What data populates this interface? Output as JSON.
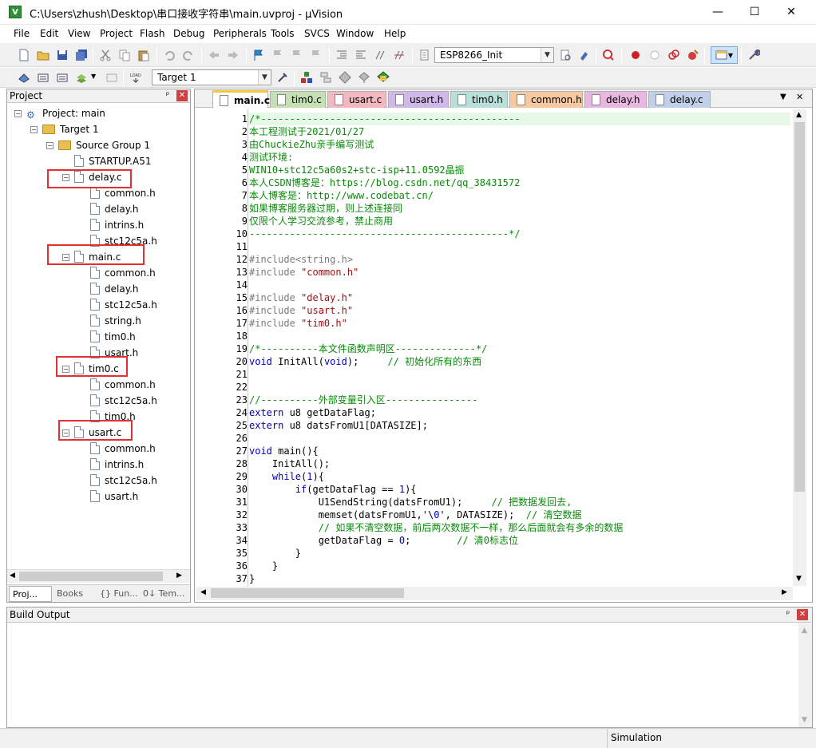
{
  "window": {
    "title": "C:\\Users\\zhush\\Desktop\\串口接收字符串\\main.uvproj - µVision",
    "app_icon_letter": "V",
    "minimize": "—",
    "maximize": "☐",
    "close": "✕"
  },
  "menu": [
    "File",
    "Edit",
    "View",
    "Project",
    "Flash",
    "Debug",
    "Peripherals",
    "Tools",
    "SVCS",
    "Window",
    "Help"
  ],
  "toolbar": {
    "target_combo": "ESP8266_Init",
    "target_select": "Target 1"
  },
  "project_panel": {
    "title": "Project",
    "pin": "ᵖ",
    "close": "✕",
    "tree": {
      "root": "Project: main",
      "target": "Target 1",
      "group": "Source Group 1",
      "files": [
        {
          "name": "STARTUP.A51",
          "children": []
        },
        {
          "name": "delay.c",
          "children": [
            "common.h",
            "delay.h",
            "intrins.h",
            "stc12c5a.h"
          ]
        },
        {
          "name": "main.c",
          "children": [
            "common.h",
            "delay.h",
            "stc12c5a.h",
            "string.h",
            "tim0.h",
            "usart.h"
          ]
        },
        {
          "name": "tim0.c",
          "children": [
            "common.h",
            "stc12c5a.h",
            "tim0.h"
          ]
        },
        {
          "name": "usart.c",
          "children": [
            "common.h",
            "intrins.h",
            "stc12c5a.h",
            "usart.h"
          ]
        }
      ]
    },
    "tabs": [
      "Proj...",
      "Books",
      "{} Fun...",
      "0↓ Tem..."
    ]
  },
  "editor": {
    "tabs": [
      {
        "label": "main.c",
        "color": "#f5c842",
        "active": true
      },
      {
        "label": "tim0.c",
        "color": "#c5e0b4",
        "active": false
      },
      {
        "label": "usart.c",
        "color": "#f4b8c0",
        "active": false
      },
      {
        "label": "usart.h",
        "color": "#d0b8e8",
        "active": false
      },
      {
        "label": "tim0.h",
        "color": "#b8e0d8",
        "active": false
      },
      {
        "label": "common.h",
        "color": "#f8c8a0",
        "active": false
      },
      {
        "label": "delay.h",
        "color": "#e8b8e0",
        "active": false
      },
      {
        "label": "delay.c",
        "color": "#c0d0e8",
        "active": false
      }
    ],
    "tab_menu": "▼",
    "tab_close": "✕",
    "code": [
      {
        "n": "1",
        "t": "/*---------------------------------------------",
        "c": "cm"
      },
      {
        "n": "2",
        "t": "本工程测试于2021/01/27",
        "c": "cm"
      },
      {
        "n": "3",
        "t": "由ChuckieZhu亲手编写测试",
        "c": "cm"
      },
      {
        "n": "4",
        "t": "测试环境:",
        "c": "cm"
      },
      {
        "n": "5",
        "t": "WIN10+stc12c5a60s2+stc-isp+11.0592晶振",
        "c": "cm"
      },
      {
        "n": "6",
        "t": "本人CSDN博客是：https://blog.csdn.net/qq_38431572",
        "c": "cm"
      },
      {
        "n": "7",
        "t": "本人博客是：http://www.codebat.cn/",
        "c": "cm"
      },
      {
        "n": "8",
        "t": "如果博客服务器过期，则上述连接同",
        "c": "cm"
      },
      {
        "n": "9",
        "t": "仅限个人学习交流参考，禁止商用",
        "c": "cm"
      },
      {
        "n": "10",
        "t": "---------------------------------------------*/",
        "c": "cm"
      },
      {
        "n": "11",
        "t": "",
        "c": "pl"
      },
      {
        "n": "12",
        "t": "#include<string.h>",
        "c": "pp"
      },
      {
        "n": "13",
        "t": "#include \"common.h\"",
        "c": "pp"
      },
      {
        "n": "14",
        "t": "",
        "c": "pl"
      },
      {
        "n": "15",
        "t": "#include \"delay.h\"",
        "c": "pp"
      },
      {
        "n": "16",
        "t": "#include \"usart.h\"",
        "c": "pp"
      },
      {
        "n": "17",
        "t": "#include \"tim0.h\"",
        "c": "pp"
      },
      {
        "n": "18",
        "t": "",
        "c": "pl"
      },
      {
        "n": "19",
        "t": "/*----------本文件函数声明区--------------*/",
        "c": "cm"
      },
      {
        "n": "20",
        "t": "void InitAll(void);     // 初始化所有的东西",
        "c": "mix20"
      },
      {
        "n": "21",
        "t": "",
        "c": "pl"
      },
      {
        "n": "22",
        "t": "",
        "c": "pl"
      },
      {
        "n": "23",
        "t": "//----------外部变量引入区----------------",
        "c": "cm"
      },
      {
        "n": "24",
        "t": "extern u8 getDataFlag;",
        "c": "mixkw"
      },
      {
        "n": "25",
        "t": "extern u8 datsFromU1[DATASIZE];",
        "c": "mixkw"
      },
      {
        "n": "26",
        "t": "",
        "c": "pl"
      },
      {
        "n": "27",
        "t": "void main(){",
        "c": "mixkw"
      },
      {
        "n": "28",
        "t": "    InitAll();",
        "c": "pl"
      },
      {
        "n": "29",
        "t": "    while(1){",
        "c": "mixkw"
      },
      {
        "n": "30",
        "t": "        if(getDataFlag == 1){",
        "c": "mixkw"
      },
      {
        "n": "31",
        "t": "            U1SendString(datsFromU1);     // 把数据发回去,",
        "c": "mixcm"
      },
      {
        "n": "32",
        "t": "            memset(datsFromU1,'\\0', DATASIZE);  // 清空数据",
        "c": "mixcm"
      },
      {
        "n": "33",
        "t": "            // 如果不清空数据，前后两次数据不一样，那么后面就会有多余的数据",
        "c": "cm"
      },
      {
        "n": "34",
        "t": "            getDataFlag = 0;        // 清0标志位",
        "c": "mixcm"
      },
      {
        "n": "35",
        "t": "        }",
        "c": "pl"
      },
      {
        "n": "36",
        "t": "    }",
        "c": "pl"
      },
      {
        "n": "37",
        "t": "}",
        "c": "pl"
      }
    ]
  },
  "build_output": {
    "title": "Build Output",
    "pin": "ᵖ",
    "close": "✕"
  },
  "status": {
    "mode": "Simulation"
  },
  "colors": {
    "highlight_box": "#e03030",
    "comment": "#0a8a0a",
    "keyword": "#0000c0",
    "preprocessor": "#7a7a7a",
    "string": "#a01010",
    "current_line": "#e8f8e8"
  }
}
